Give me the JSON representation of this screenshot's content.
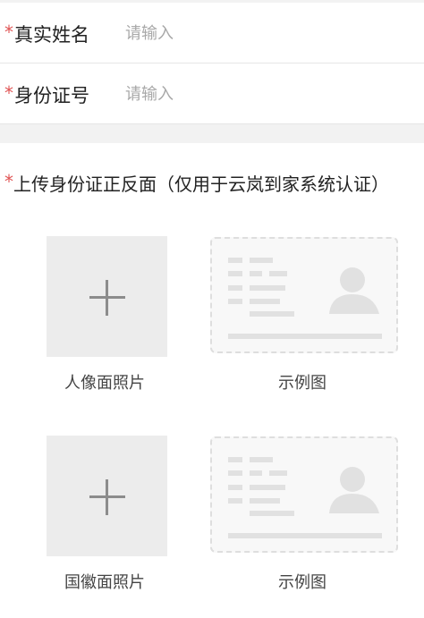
{
  "form": {
    "name_field": {
      "required_mark": "*",
      "label": "真实姓名",
      "placeholder": "请输入",
      "value": ""
    },
    "id_field": {
      "required_mark": "*",
      "label": "身份证号",
      "placeholder": "请输入",
      "value": ""
    }
  },
  "upload": {
    "required_mark": "*",
    "title": "上传身份证正反面（仅用于云岚到家系统认证）",
    "front": {
      "caption": "人像面照片",
      "icon": "plus-icon",
      "example_caption": "示例图"
    },
    "back": {
      "caption": "国徽面照片",
      "icon": "plus-icon",
      "example_caption": "示例图"
    }
  },
  "colors": {
    "required": "#e05454",
    "placeholder": "#a8a8a8",
    "upload_box": "#ececec"
  }
}
